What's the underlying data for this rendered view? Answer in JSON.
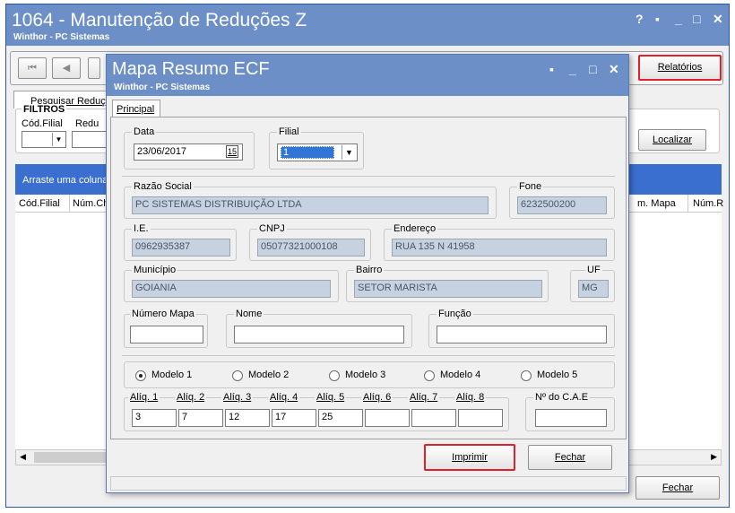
{
  "main_window": {
    "title": "1064 - Manutenção de Reduções Z",
    "subtitle": "Winthor - PC Sistemas",
    "controls": [
      "?",
      "▪",
      "_",
      "□",
      "✕"
    ],
    "nav_first": "⏮",
    "nav_prev": "◀",
    "tab_label": "Pesquisar Reduçõ",
    "filters_label": "FILTROS",
    "filter_cod_filial_label": "Cód.Filial",
    "filter_reducao_label": "Redu",
    "relatorios_button": "Relatórios",
    "localizar_button": "Localizar",
    "group_panel_text": "Arraste uma coluna",
    "columns": [
      "Cód.Filial",
      "Núm.Ch",
      "m. Mapa",
      "Núm.R"
    ],
    "fechar_button": "Fechar"
  },
  "dialog": {
    "title": "Mapa Resumo ECF",
    "subtitle": "Winthor - PC Sistemas",
    "controls": [
      "▪",
      "_",
      "□",
      "✕"
    ],
    "tab_label": "Principal",
    "data_label": "Data",
    "data_value": "23/06/2017",
    "calendar_icon_text": "15",
    "filial_label": "Filial",
    "filial_value": "1",
    "razao_social_label": "Razão Social",
    "razao_social_value": "PC SISTEMAS DISTRIBUIÇÃO LTDA",
    "fone_label": "Fone",
    "fone_value": "6232500200",
    "ie_label": "I.E.",
    "ie_value": "0962935387",
    "cnpj_label": "CNPJ",
    "cnpj_value": "05077321000108",
    "endereco_label": "Endereço",
    "endereco_value": "RUA 135 N 41958",
    "municipio_label": "Município",
    "municipio_value": "GOIANIA",
    "bairro_label": "Bairro",
    "bairro_value": "SETOR MARISTA",
    "uf_label": "UF",
    "uf_value": "MG",
    "numero_mapa_label": "Número Mapa",
    "numero_mapa_value": "",
    "nome_label": "Nome",
    "nome_value": "",
    "funcao_label": "Função",
    "funcao_value": "",
    "modelos": [
      "Modelo 1",
      "Modelo 2",
      "Modelo 3",
      "Modelo 4",
      "Modelo 5"
    ],
    "modelo_selected": 0,
    "aliq_labels": [
      "Alíq. 1",
      "Alíq. 2",
      "Alíq. 3",
      "Alíq. 4",
      "Alíq. 5",
      "Alíq. 6",
      "Alíq. 7",
      "Alíq. 8"
    ],
    "aliq_values": [
      "3",
      "7",
      "12",
      "17",
      "25",
      "",
      "",
      ""
    ],
    "cae_label": "Nº do C.A.E",
    "cae_value": "",
    "imprimir_button": "Imprimir",
    "fechar_button": "Fechar"
  },
  "colors": {
    "title_bar": "#6d8fc7",
    "grid_header": "#3b6fcf",
    "highlight": "#e0202a",
    "readonly_field": "#c7d2e0"
  }
}
